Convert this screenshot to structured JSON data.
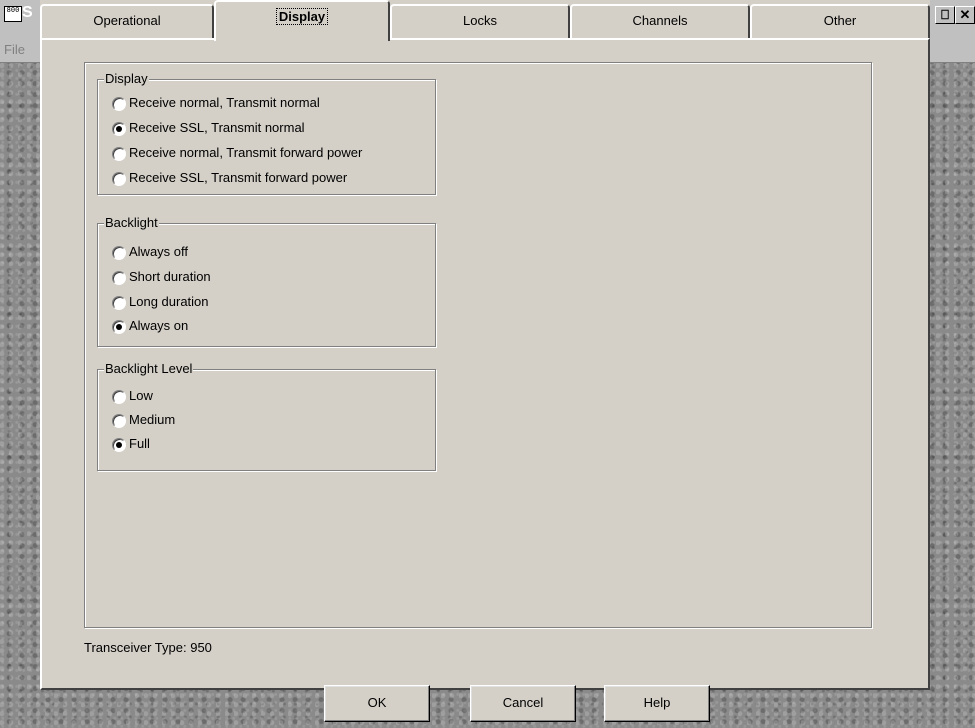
{
  "app": {
    "icon_glyph": "800",
    "title_fragment": "S",
    "menu_file": "File",
    "ctrl_restore": "⎕",
    "ctrl_close": "✕"
  },
  "tabs": [
    {
      "label": "Operational",
      "active": false
    },
    {
      "label": "Display",
      "active": true
    },
    {
      "label": "Locks",
      "active": false
    },
    {
      "label": "Channels",
      "active": false
    },
    {
      "label": "Other",
      "active": false
    }
  ],
  "groups": {
    "display": {
      "label": "Display",
      "options": [
        {
          "label": "Receive normal, Transmit normal",
          "selected": false
        },
        {
          "label": "Receive SSL, Transmit normal",
          "selected": true
        },
        {
          "label": "Receive normal, Transmit forward power",
          "selected": false
        },
        {
          "label": "Receive SSL, Transmit forward power",
          "selected": false
        }
      ]
    },
    "backlight": {
      "label": "Backlight",
      "options": [
        {
          "label": "Always off",
          "selected": false
        },
        {
          "label": "Short duration",
          "selected": false
        },
        {
          "label": "Long duration",
          "selected": false
        },
        {
          "label": "Always on",
          "selected": true
        }
      ]
    },
    "backlight_level": {
      "label": "Backlight Level",
      "options": [
        {
          "label": "Low",
          "selected": false
        },
        {
          "label": "Medium",
          "selected": false
        },
        {
          "label": "Full",
          "selected": true
        }
      ]
    }
  },
  "footer": {
    "transceiver_type": "Transceiver Type: 950"
  },
  "buttons": {
    "ok": "OK",
    "cancel": "Cancel",
    "help": "Help"
  }
}
